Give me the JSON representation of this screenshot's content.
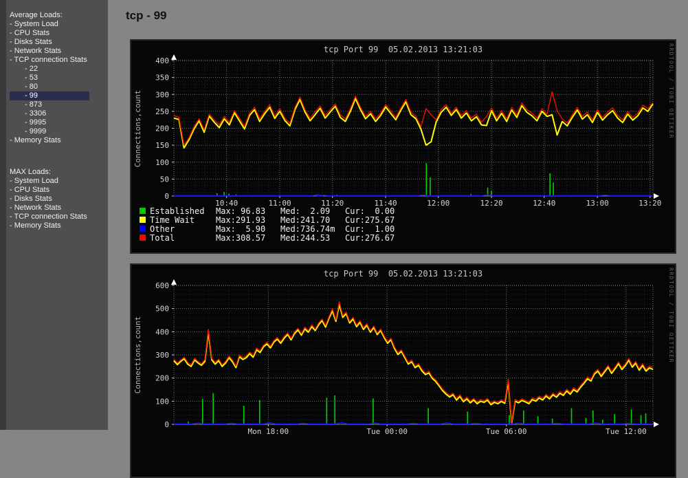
{
  "page": {
    "title": "tcp - 99"
  },
  "sidebar": {
    "bullet": "-",
    "groups": [
      {
        "header": "Average Loads:",
        "items": [
          {
            "label": "System Load",
            "sub": false
          },
          {
            "label": "CPU Stats",
            "sub": false
          },
          {
            "label": "Disks Stats",
            "sub": false
          },
          {
            "label": "Network Stats",
            "sub": false
          },
          {
            "label": "TCP connection Stats",
            "sub": false
          },
          {
            "label": "22",
            "sub": true
          },
          {
            "label": "53",
            "sub": true
          },
          {
            "label": "80",
            "sub": true
          },
          {
            "label": "99",
            "sub": true,
            "selected": true
          },
          {
            "label": "873",
            "sub": true
          },
          {
            "label": "3306",
            "sub": true
          },
          {
            "label": "9995",
            "sub": true
          },
          {
            "label": "9999",
            "sub": true
          },
          {
            "label": "Memory Stats",
            "sub": false
          }
        ]
      },
      {
        "header": "MAX Loads:",
        "items": [
          {
            "label": "System Load",
            "sub": false
          },
          {
            "label": "CPU Stats",
            "sub": false
          },
          {
            "label": "Disks Stats",
            "sub": false
          },
          {
            "label": "Network Stats",
            "sub": false
          },
          {
            "label": "TCP connection Stats",
            "sub": false
          },
          {
            "label": "Memory Stats",
            "sub": false
          }
        ]
      }
    ]
  },
  "colors": {
    "page_bg": "#858585",
    "sidebar_bg": "#4f4f52",
    "selected_bg": "#2a2d50",
    "panel_bg": "#060606",
    "established": "#00d400",
    "time_wait": "#ffff00",
    "other": "#1313ff",
    "total": "#ee1100",
    "grid_major": "rgba(185,215,185,0.55)",
    "grid_minor": "rgba(135,155,135,0.22)",
    "tick_text": "#d6d6d6"
  },
  "chart_data": [
    {
      "type": "line",
      "title": "tcp Port 99  05.02.2013 13:21:03",
      "ylabel": "Connections,count",
      "watermark": "RRDTOOL / TOBI OETIKER",
      "ylim": [
        0,
        400
      ],
      "yticks": [
        0,
        50,
        100,
        150,
        200,
        250,
        300,
        350,
        400
      ],
      "y_major_step": 50,
      "y_minor_step": 10,
      "x_minor_per_major": 5,
      "grid": true,
      "legend_position": "bottom",
      "xticks": [
        {
          "pos": 0.11,
          "label": "10:40"
        },
        {
          "pos": 0.221,
          "label": "11:00"
        },
        {
          "pos": 0.331,
          "label": "11:20"
        },
        {
          "pos": 0.442,
          "label": "11:40"
        },
        {
          "pos": 0.552,
          "label": "12:00"
        },
        {
          "pos": 0.663,
          "label": "12:20"
        },
        {
          "pos": 0.773,
          "label": "12:40"
        },
        {
          "pos": 0.884,
          "label": "13:00"
        },
        {
          "pos": 0.994,
          "label": "13:20"
        }
      ],
      "legend": [
        {
          "label": "Established",
          "color": "#00c800",
          "max": "Max: 96.83",
          "med": "Med:  2.09",
          "cur": "Cur:  0.00"
        },
        {
          "label": "Time Wait",
          "color": "#ffff00",
          "max": "Max:291.93",
          "med": "Med:241.70",
          "cur": "Cur:275.67"
        },
        {
          "label": "Other",
          "color": "#0000ff",
          "max": "Max:  5.90",
          "med": "Med:736.74m",
          "cur": "Cur:  1.00"
        },
        {
          "label": "Total",
          "color": "#ff0000",
          "max": "Max:308.57",
          "med": "Med:244.53",
          "cur": "Cur:276.67"
        }
      ],
      "series": [
        {
          "name": "Established",
          "color": "#00d400",
          "render": "needle",
          "width": 1.6,
          "spikes": [
            [
              0.09,
              8
            ],
            [
              0.105,
              12
            ],
            [
              0.115,
              7
            ],
            [
              0.13,
              5
            ],
            [
              0.34,
              4
            ],
            [
              0.527,
              97
            ],
            [
              0.535,
              55
            ],
            [
              0.62,
              6
            ],
            [
              0.655,
              25
            ],
            [
              0.663,
              15
            ],
            [
              0.785,
              67
            ],
            [
              0.792,
              40
            ]
          ]
        },
        {
          "name": "Time Wait",
          "color": "#ffff00",
          "render": "line",
          "width": 2,
          "values": [
            230,
            226,
            142,
            166,
            198,
            222,
            188,
            236,
            218,
            202,
            228,
            210,
            246,
            222,
            198,
            238,
            255,
            220,
            243,
            262,
            229,
            250,
            223,
            207,
            255,
            285,
            248,
            222,
            240,
            259,
            230,
            248,
            265,
            232,
            220,
            250,
            288,
            255,
            228,
            243,
            220,
            238,
            263,
            244,
            225,
            253,
            278,
            240,
            228,
            197,
            150,
            160,
            218,
            247,
            262,
            238,
            255,
            230,
            245,
            222,
            234,
            210,
            208,
            252,
            222,
            244,
            220,
            254,
            232,
            267,
            247,
            237,
            222,
            250,
            235,
            240,
            180,
            220,
            207,
            232,
            254,
            227,
            240,
            217,
            247,
            224,
            240,
            252,
            230,
            217,
            242,
            224,
            237,
            260,
            250,
            272
          ]
        },
        {
          "name": "Other",
          "color": "#1313ff",
          "render": "baseline",
          "width": 1.4,
          "value": 1,
          "bumps": [
            [
              0.3,
              4
            ],
            [
              0.31,
              3
            ],
            [
              0.52,
              3
            ],
            [
              0.655,
              4
            ],
            [
              0.9,
              3
            ]
          ]
        },
        {
          "name": "Total",
          "color": "#ee1100",
          "render": "line",
          "width": 1.4,
          "values": [
            238,
            232,
            150,
            172,
            205,
            228,
            196,
            242,
            225,
            210,
            235,
            218,
            252,
            230,
            205,
            245,
            262,
            228,
            250,
            270,
            236,
            258,
            230,
            215,
            262,
            292,
            255,
            230,
            248,
            266,
            238,
            255,
            272,
            240,
            228,
            258,
            295,
            262,
            235,
            250,
            228,
            245,
            270,
            252,
            232,
            260,
            285,
            248,
            235,
            205,
            258,
            240,
            225,
            255,
            270,
            245,
            262,
            238,
            252,
            230,
            242,
            218,
            235,
            260,
            230,
            252,
            228,
            262,
            240,
            275,
            255,
            245,
            230,
            258,
            242,
            308,
            252,
            228,
            215,
            240,
            262,
            235,
            248,
            225,
            255,
            232,
            248,
            260,
            238,
            225,
            250,
            232,
            245,
            268,
            258,
            276
          ]
        }
      ]
    },
    {
      "type": "line",
      "title": "tcp Port 99  05.02.2013 13:21:03",
      "ylabel": "Connections,count",
      "watermark": "RRDTOOL / TOBI OETIKER",
      "ylim": [
        0,
        600
      ],
      "yticks": [
        0,
        100,
        200,
        300,
        400,
        500,
        600
      ],
      "y_major_step": 100,
      "y_minor_step": 20,
      "x_minor_per_major": 6,
      "grid": true,
      "legend_position": "bottom-cut-off",
      "xticks": [
        {
          "pos": 0.197,
          "label": "Mon 18:00"
        },
        {
          "pos": 0.445,
          "label": "Tue 00:00"
        },
        {
          "pos": 0.694,
          "label": "Tue 06:00"
        },
        {
          "pos": 0.944,
          "label": "Tue 12:00"
        }
      ],
      "legend": [],
      "series": [
        {
          "name": "Established",
          "color": "#00d400",
          "render": "needle",
          "width": 1.6,
          "spikes": [
            [
              0.03,
              12
            ],
            [
              0.06,
              110
            ],
            [
              0.082,
              135
            ],
            [
              0.146,
              80
            ],
            [
              0.179,
              105
            ],
            [
              0.319,
              115
            ],
            [
              0.336,
              125
            ],
            [
              0.416,
              112
            ],
            [
              0.531,
              70
            ],
            [
              0.613,
              55
            ],
            [
              0.7,
              40
            ],
            [
              0.73,
              60
            ],
            [
              0.76,
              35
            ],
            [
              0.79,
              25
            ],
            [
              0.83,
              70
            ],
            [
              0.86,
              28
            ],
            [
              0.875,
              60
            ],
            [
              0.895,
              20
            ],
            [
              0.92,
              45
            ],
            [
              0.955,
              65
            ],
            [
              0.975,
              40
            ],
            [
              0.985,
              48
            ]
          ]
        },
        {
          "name": "Time Wait",
          "color": "#ffff00",
          "render": "line",
          "width": 2,
          "values": [
            275,
            258,
            272,
            283,
            260,
            250,
            278,
            265,
            255,
            272,
            400,
            278,
            260,
            275,
            250,
            265,
            288,
            270,
            245,
            292,
            280,
            288,
            305,
            290,
            322,
            310,
            335,
            347,
            330,
            355,
            368,
            350,
            372,
            388,
            365,
            392,
            408,
            385,
            412,
            398,
            422,
            405,
            430,
            448,
            420,
            458,
            490,
            445,
            518,
            462,
            478,
            438,
            455,
            422,
            440,
            410,
            428,
            398,
            418,
            388,
            405,
            375,
            350,
            365,
            328,
            302,
            315,
            288,
            260,
            270,
            245,
            255,
            230,
            215,
            222,
            198,
            185,
            165,
            145,
            130,
            118,
            128,
            105,
            120,
            98,
            110,
            93,
            105,
            89,
            100,
            95,
            105,
            85,
            95,
            89,
            99,
            91,
            186,
            2,
            100,
            93,
            103,
            97,
            89,
            107,
            100,
            114,
            105,
            122,
            110,
            128,
            117,
            134,
            125,
            144,
            130,
            150,
            140,
            160,
            177,
            197,
            187,
            217,
            230,
            207,
            227,
            247,
            220,
            240,
            262,
            237,
            254,
            277,
            247,
            264,
            234,
            254,
            230,
            244,
            237
          ]
        },
        {
          "name": "Other",
          "color": "#1313ff",
          "render": "baseline",
          "width": 1.4,
          "value": 2,
          "bumps": [
            [
              0.05,
              6
            ],
            [
              0.12,
              5
            ],
            [
              0.2,
              7
            ],
            [
              0.27,
              5
            ],
            [
              0.35,
              8
            ],
            [
              0.42,
              6
            ],
            [
              0.5,
              5
            ],
            [
              0.57,
              7
            ],
            [
              0.63,
              5
            ],
            [
              0.72,
              6
            ],
            [
              0.8,
              5
            ],
            [
              0.88,
              7
            ],
            [
              0.95,
              5
            ]
          ]
        },
        {
          "name": "Total",
          "color": "#ee1100",
          "render": "line",
          "width": 1.4,
          "values": [
            282,
            265,
            278,
            290,
            268,
            258,
            285,
            272,
            262,
            280,
            410,
            285,
            268,
            282,
            258,
            272,
            295,
            278,
            252,
            300,
            288,
            296,
            312,
            298,
            330,
            318,
            342,
            355,
            338,
            362,
            375,
            358,
            380,
            395,
            372,
            400,
            415,
            392,
            420,
            405,
            430,
            412,
            438,
            455,
            428,
            465,
            500,
            452,
            530,
            470,
            485,
            445,
            462,
            430,
            448,
            418,
            435,
            405,
            425,
            395,
            412,
            382,
            358,
            372,
            335,
            310,
            322,
            295,
            268,
            278,
            252,
            262,
            238,
            222,
            230,
            205,
            192,
            172,
            152,
            138,
            125,
            135,
            112,
            128,
            105,
            118,
            100,
            112,
            96,
            108,
            102,
            112,
            92,
            102,
            96,
            106,
            98,
            195,
            5,
            108,
            100,
            110,
            104,
            96,
            115,
            108,
            122,
            112,
            130,
            118,
            135,
            125,
            142,
            132,
            152,
            138,
            158,
            148,
            168,
            185,
            205,
            195,
            225,
            238,
            215,
            235,
            255,
            228,
            248,
            270,
            245,
            262,
            285,
            255,
            272,
            242,
            262,
            238,
            252,
            245
          ]
        }
      ]
    }
  ]
}
